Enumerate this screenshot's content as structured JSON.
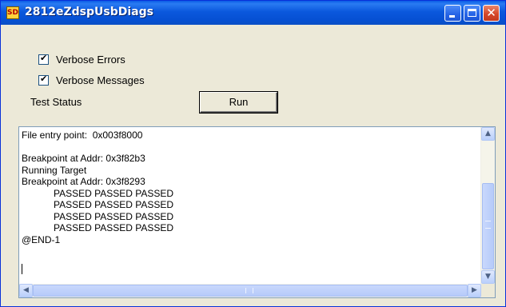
{
  "window": {
    "title": "2812eZdspUsbDiags",
    "icon": "app-icon",
    "minimize_icon": "minimize-icon",
    "maximize_icon": "maximize-icon",
    "close_label": "✕"
  },
  "options": {
    "verbose_errors_label": "Verbose Errors",
    "verbose_errors_checked": true,
    "verbose_messages_label": "Verbose Messages",
    "verbose_messages_checked": true,
    "check_mark": "✔"
  },
  "test": {
    "status_label": "Test Status",
    "run_label": "Run"
  },
  "log": {
    "text": "File entry point:  0x003f8000\n\nBreakpoint at Addr: 0x3f82b3\nRunning Target\nBreakpoint at Addr: 0x3f8293\n            PASSED PASSED PASSED\n            PASSED PASSED PASSED\n            PASSED PASSED PASSED\n            PASSED PASSED PASSED\n@END-1"
  },
  "scrollbars": {
    "up_arrow": "▲",
    "down_arrow": "▼",
    "left_arrow": "◀",
    "right_arrow": "▶"
  },
  "colors": {
    "titlebar": "#0a5ce6",
    "face": "#ece9d8",
    "close_button": "#d6472a"
  }
}
